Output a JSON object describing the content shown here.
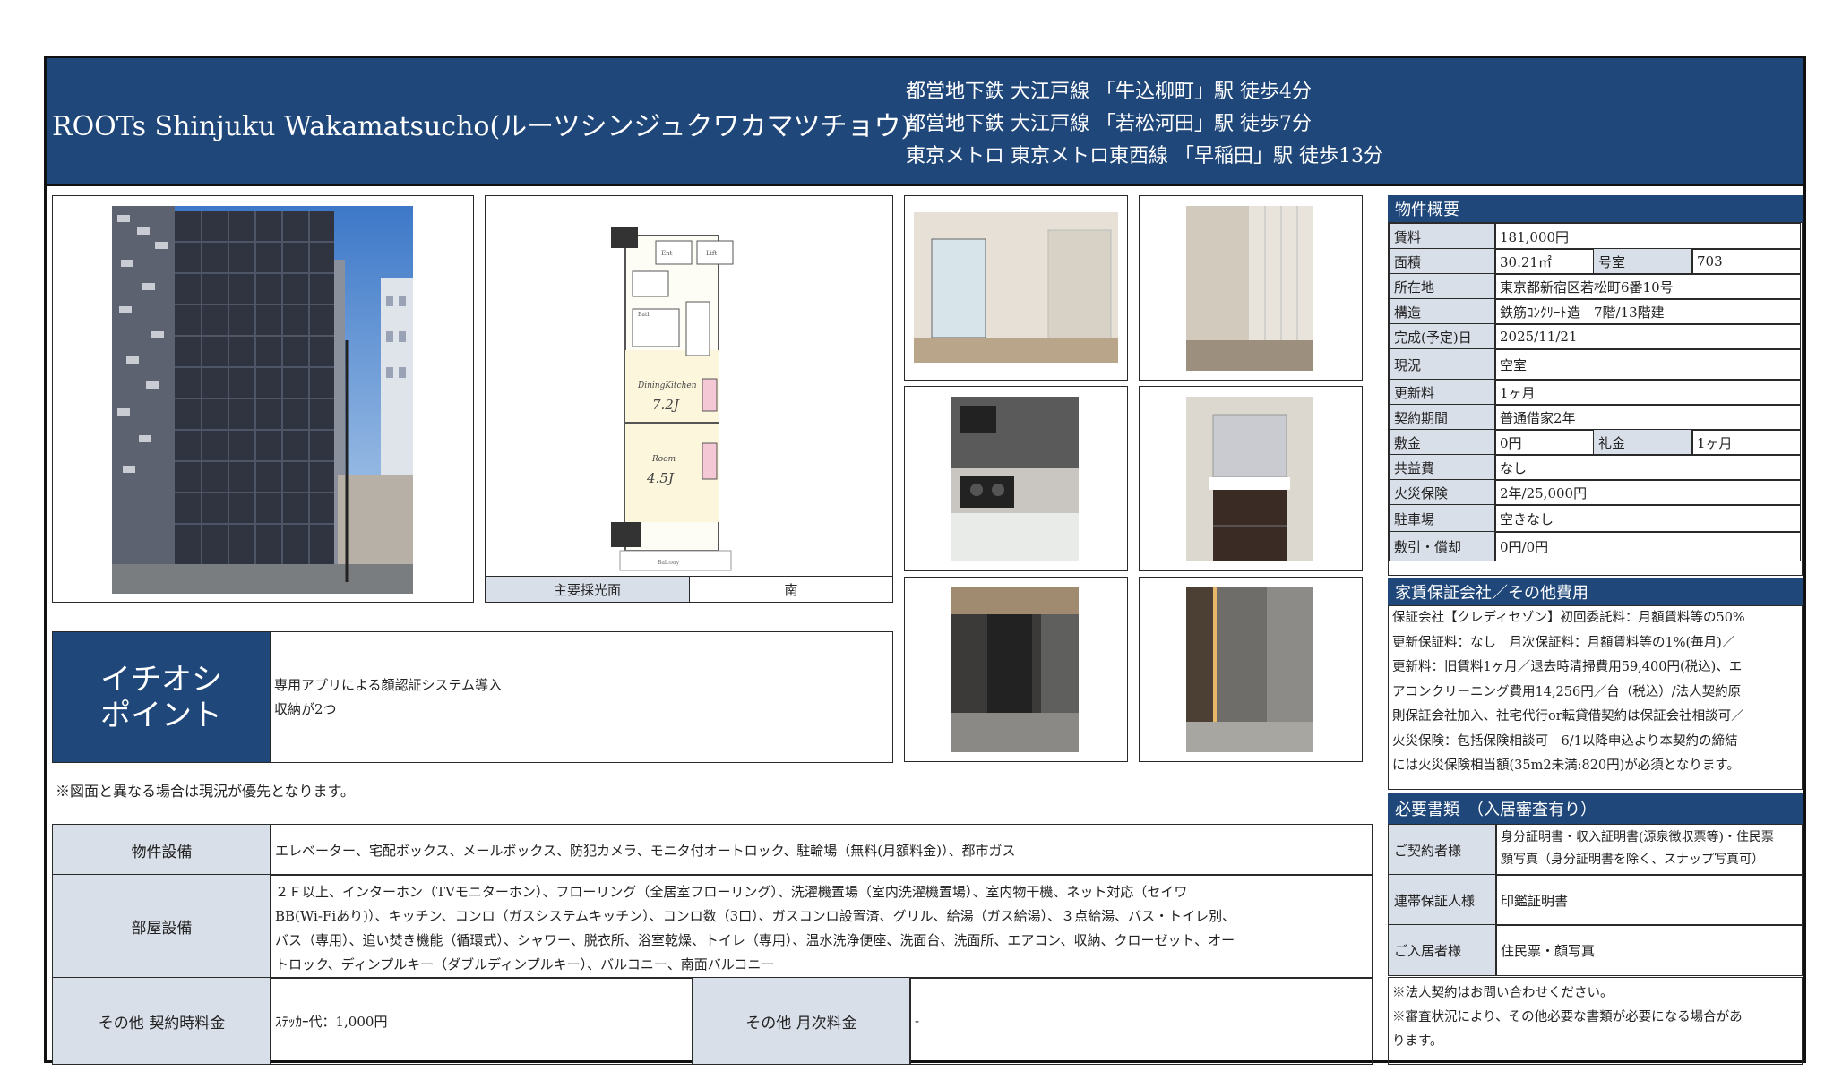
{
  "header": {
    "title": "ROOTs Shinjuku Wakamatsucho(ルーツシンジュクワカマツチョウ)",
    "stations": [
      "都営地下鉄 大江戸線 「牛込柳町」駅 徒歩4分",
      "都営地下鉄 大江戸線 「若松河田」駅 徒歩7分",
      "東京メトロ 東京メトロ東西線 「早稲田」駅 徒歩13分"
    ]
  },
  "floorplan": {
    "labels": [
      "Ent",
      "Lift",
      "DiningKitchen",
      "7.2J",
      "Room",
      "4.5J",
      "Bath",
      "Balcony"
    ],
    "light_label": "主要採光面",
    "light_value": "南"
  },
  "highlight": {
    "title_line1": "イチオシ",
    "title_line2": "ポイント",
    "points": [
      "専用アプリによる顔認証システム導入",
      "収納が2つ"
    ]
  },
  "note": "※図面と異なる場合は現況が優先となります。",
  "overview": {
    "title": "物件概要",
    "rent_label": "賃料",
    "rent": "181,000円",
    "area_label": "面積",
    "area": "30.21㎡",
    "room_label": "号室",
    "room": "703",
    "address_label": "所在地",
    "address": "東京都新宿区若松町6番10号",
    "structure_label": "構造",
    "structure": "鉄筋ｺﾝｸﾘｰﾄ造　7階/13階建",
    "completion_label": "完成(予定)日",
    "completion": "2025/11/21",
    "status_label": "現況",
    "status": "空室",
    "renewal_label": "更新料",
    "renewal": "1ヶ月",
    "term_label": "契約期間",
    "term": "普通借家2年",
    "deposit_label": "敷金",
    "deposit": "0円",
    "keymoney_label": "礼金",
    "keymoney": "1ヶ月",
    "common_label": "共益費",
    "common": "なし",
    "fire_label": "火災保険",
    "fire": "2年/25,000円",
    "parking_label": "駐車場",
    "parking": "空きなし",
    "shiki_label": "敷引・償却",
    "shiki": "0円/0円"
  },
  "guarantee": {
    "title": "家賃保証会社／その他費用",
    "lines": [
      "保証会社【クレディセゾン】初回委託料：月額賃料等の50%",
      "更新保証料：なし　月次保証料：月額賃料等の1%(毎月)／",
      "更新料：旧賃料1ヶ月／退去時清掃費用59,400円(税込)、エ",
      "アコンクリーニング費用14,256円／台（税込）/法人契約原",
      "則保証会社加入、社宅代行or転貸借契約は保証会社相談可／",
      "火災保険：包括保険相談可　6/1以降申込より本契約の締結",
      "には火災保険相当額(35m2未満:820円)が必須となります。"
    ]
  },
  "documents": {
    "title": "必要書類　（入居審査有り）",
    "rows": [
      {
        "label": "ご契約者様",
        "lines": [
          "身分証明書・収入証明書(源泉徴収票等)・住民票",
          "顔写真（身分証明書を除く、スナップ写真可）"
        ]
      },
      {
        "label": "連帯保証人様",
        "lines": [
          "印鑑証明書"
        ]
      },
      {
        "label": "ご入居者様",
        "lines": [
          "住民票・顔写真"
        ]
      }
    ],
    "notes": [
      "※法人契約はお問い合わせください。",
      "※審査状況により、その他必要な書類が必要になる場合があ",
      "ります。"
    ]
  },
  "facilities": {
    "building_label": "物件設備",
    "building": "エレベーター、宅配ボックス、メールボックス、防犯カメラ、モニタ付オートロック、駐輪場（無料(月額料金)）、都市ガス",
    "room_label": "部屋設備",
    "room_lines": [
      "２Ｆ以上、インターホン（TVモニターホン）、フローリング（全居室フローリング）、洗濯機置場（室内洗濯機置場）、室内物干機、ネット対応（セイワ",
      "BB(Wi-Fiあり)）、キッチン、コンロ（ガスシステムキッチン）、コンロ数（3口）、ガスコンロ設置済、グリル、給湯（ガス給湯）、３点給湯、バス・トイレ別、",
      "バス（専用）、追い焚き機能（循環式）、シャワー、脱衣所、浴室乾燥、トイレ（専用）、温水洗浄便座、洗面台、洗面所、エアコン、収納、クローゼット、オー",
      "トロック、ディンプルキー（ダブルディンプルキー）、バルコニー、南面バルコニー"
    ],
    "contract_label": "その他 契約時料金",
    "contract": "ｽﾃｯｶｰ代：1,000円",
    "monthly_label": "その他 月次料金",
    "monthly": "-"
  },
  "colors": {
    "navy": "#1f477a",
    "label_bg": "#d9dfe9",
    "border": "#2a2a2a"
  }
}
